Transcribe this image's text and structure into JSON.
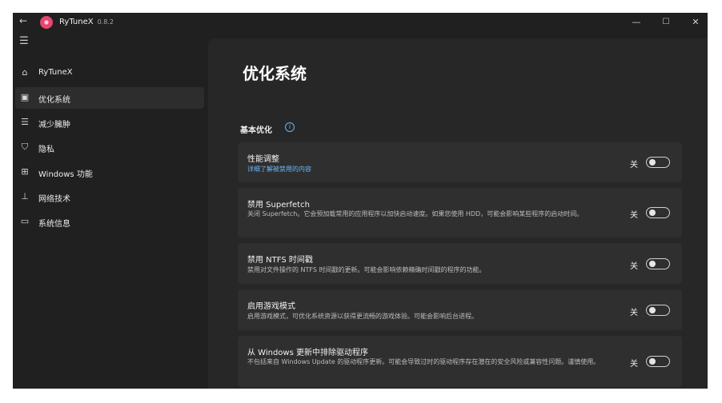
{
  "titlebar": {
    "back_icon": "back-arrow-icon",
    "app_name": "RyTuneX",
    "version": "0.8.2",
    "minimize": "—",
    "maximize": "☐",
    "close": "✕"
  },
  "sidebar": {
    "menu_icon": "hamburger-icon",
    "items": [
      {
        "label": "RyTuneX",
        "icon": "home-icon",
        "active": false
      },
      {
        "label": "优化系统",
        "icon": "optimize-icon",
        "active": true
      },
      {
        "label": "减少臃肿",
        "icon": "list-icon",
        "active": false
      },
      {
        "label": "隐私",
        "icon": "shield-icon",
        "active": false
      },
      {
        "label": "Windows 功能",
        "icon": "apps-icon",
        "active": false
      },
      {
        "label": "网络技术",
        "icon": "network-icon",
        "active": false
      },
      {
        "label": "系统信息",
        "icon": "laptop-icon",
        "active": false
      }
    ]
  },
  "main": {
    "title": "优化系统",
    "section_title": "基本优化",
    "section_info_icon": "info-icon",
    "cards": [
      {
        "title": "性能调整",
        "link": "详细了解被禁用的内容",
        "toggle_label": "关",
        "toggle_on": false
      },
      {
        "title": "禁用 Superfetch",
        "description": "关闭 Superfetch。它会预加载常用的应用程序以加快启动速度。如果您使用 HDD，可能会影响某些程序的启动时间。",
        "toggle_label": "关",
        "toggle_on": false
      },
      {
        "title": "禁用 NTFS 时间戳",
        "description": "禁用对文件操作的 NTFS 时间戳的更新。可能会影响依赖精确时间戳的程序的功能。",
        "toggle_label": "关",
        "toggle_on": false
      },
      {
        "title": "启用游戏模式",
        "description": "启用游戏模式，可优化系统资源以获得更流畅的游戏体验。可能会影响后台进程。",
        "toggle_label": "关",
        "toggle_on": false
      },
      {
        "title": "从 Windows 更新中排除驱动程序",
        "description": "不包括来自 Windows Update 的驱动程序更新。可能会导致过时的驱动程序存在潜在的安全风险或兼容性问题。谨慎使用。",
        "toggle_label": "关",
        "toggle_on": false
      }
    ]
  },
  "colors": {
    "window_bg": "#202020",
    "content_bg": "#272727",
    "card_bg": "#2f2f2f",
    "accent_link": "#69b7ff"
  }
}
